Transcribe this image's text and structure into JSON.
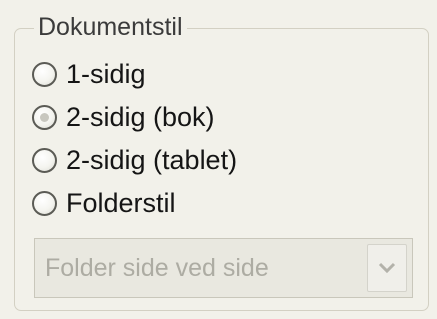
{
  "group": {
    "title": "Dokumentstil"
  },
  "options": [
    {
      "label": "1-sidig",
      "checked": false
    },
    {
      "label": "2-sidig (bok)",
      "checked": true
    },
    {
      "label": "2-sidig (tablet)",
      "checked": false
    },
    {
      "label": "Folderstil",
      "checked": false
    }
  ],
  "dropdown": {
    "value": "Folder side ved side",
    "enabled": false,
    "button_icon": "chevron-down-icon"
  },
  "colors": {
    "background": "#f2f1ea",
    "disabled_text": "#adaca3",
    "group_border": "#d3d0c3"
  }
}
